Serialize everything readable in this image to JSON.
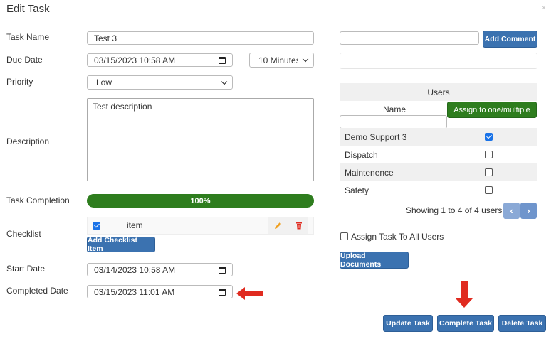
{
  "modal": {
    "title": "Edit Task",
    "close": "×"
  },
  "form": {
    "task_name": {
      "label": "Task Name",
      "value": "Test 3"
    },
    "due_date": {
      "label": "Due Date",
      "value": "03/15/2023 10:58 AM",
      "reminder": "10 Minutes"
    },
    "priority": {
      "label": "Priority",
      "value": "Low"
    },
    "description": {
      "label": "Description",
      "value": "Test description"
    },
    "task_completion": {
      "label": "Task Completion",
      "value": "100%",
      "percent": 100
    },
    "checklist": {
      "label": "Checklist",
      "items": [
        {
          "text": "item",
          "checked": true
        }
      ],
      "add_button": "Add Checklist Item"
    },
    "start_date": {
      "label": "Start Date",
      "value": "03/14/2023 10:58 AM"
    },
    "completed_date": {
      "label": "Completed Date",
      "value": "03/15/2023 11:01 AM"
    }
  },
  "comments": {
    "input_value": "",
    "add_button": "Add Comment"
  },
  "users": {
    "header": "Users",
    "name_col": "Name",
    "assign_button": "Assign to one/multiple",
    "filter_value": "",
    "rows": [
      {
        "name": "Demo Support 3",
        "checked": true
      },
      {
        "name": "Dispatch",
        "checked": false
      },
      {
        "name": "Maintenence",
        "checked": false
      },
      {
        "name": "Safety",
        "checked": false
      }
    ],
    "pager_text": "Showing 1 to 4 of 4 users",
    "prev": "‹",
    "next": "›"
  },
  "assign_all": {
    "label": "Assign Task To All Users",
    "checked": false
  },
  "upload_button": "Upload Documents",
  "footer": {
    "update": "Update Task",
    "complete": "Complete Task",
    "delete": "Delete Task"
  },
  "colors": {
    "primary": "#3b72b0",
    "success": "#2e7d1e",
    "annotation": "#e02b20"
  }
}
